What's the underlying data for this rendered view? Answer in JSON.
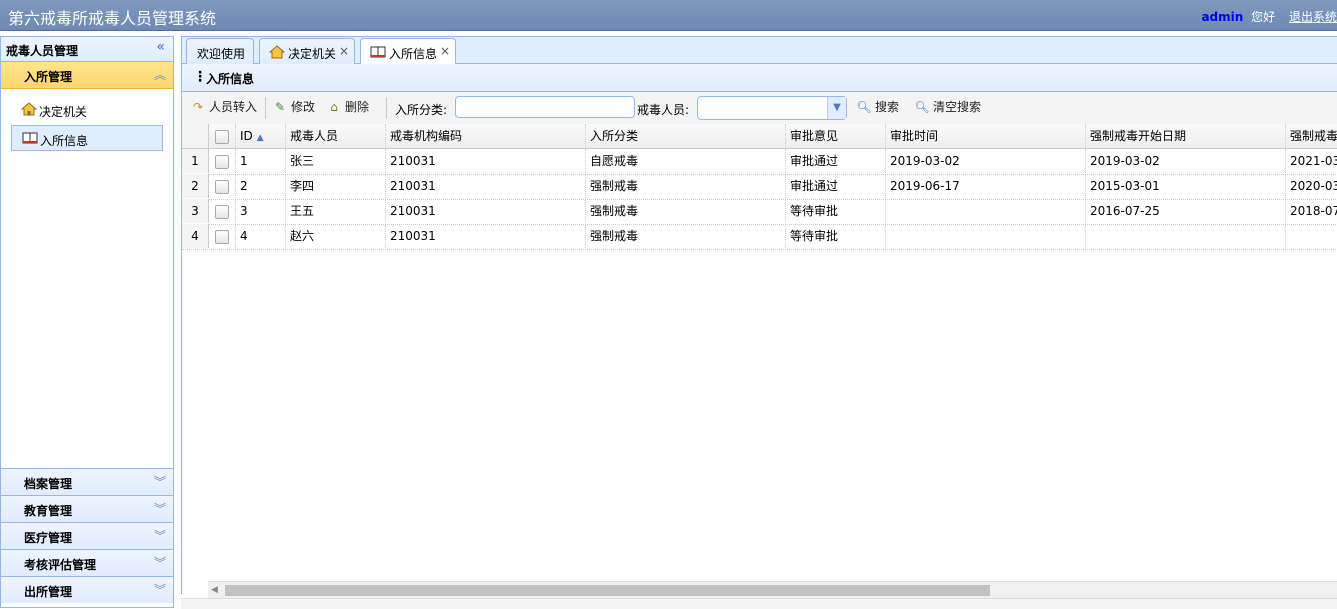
{
  "app": {
    "title": "第六戒毒所戒毒人员管理系统",
    "user": "admin",
    "greeting": "您好",
    "logout": "退出系统"
  },
  "sidebar": {
    "header": "戒毒人员管理",
    "active_group": "入所管理",
    "items": [
      {
        "label": "决定机关",
        "icon": "house-icon"
      },
      {
        "label": "入所信息",
        "icon": "book-icon"
      }
    ],
    "groups": [
      "档案管理",
      "教育管理",
      "医疗管理",
      "考核评估管理",
      "出所管理"
    ]
  },
  "tabs": [
    {
      "label": "欢迎使用"
    },
    {
      "label": "决定机关",
      "icon": "house-icon"
    },
    {
      "label": "入所信息",
      "icon": "book-icon"
    }
  ],
  "panel": {
    "title": "入所信息"
  },
  "toolbar": {
    "transfer": "人员转入",
    "edit": "修改",
    "delete": "删除",
    "category_label": "入所分类:",
    "category_value": "",
    "person_label": "戒毒人员:",
    "person_value": "",
    "search": "搜索",
    "clear": "清空搜索"
  },
  "grid": {
    "columns": [
      "ID",
      "戒毒人员",
      "戒毒机构编码",
      "入所分类",
      "审批意见",
      "审批时间",
      "强制戒毒开始日期",
      "强制戒毒"
    ],
    "rows": [
      {
        "n": "1",
        "id": "1",
        "name": "张三",
        "code": "210031",
        "cat": "自愿戒毒",
        "opinion": "审批通过",
        "time": "2019-03-02",
        "start": "2019-03-02",
        "end": "2021-03"
      },
      {
        "n": "2",
        "id": "2",
        "name": "李四",
        "code": "210031",
        "cat": "强制戒毒",
        "opinion": "审批通过",
        "time": "2019-06-17",
        "start": "2015-03-01",
        "end": "2020-03"
      },
      {
        "n": "3",
        "id": "3",
        "name": "王五",
        "code": "210031",
        "cat": "强制戒毒",
        "opinion": "等待审批",
        "time": "",
        "start": "2016-07-25",
        "end": "2018-07"
      },
      {
        "n": "4",
        "id": "4",
        "name": "赵六",
        "code": "210031",
        "cat": "强制戒毒",
        "opinion": "等待审批",
        "time": "",
        "start": "",
        "end": ""
      }
    ]
  },
  "colors": {
    "border": "#95b8e7",
    "header_bg": "#e0ecff",
    "topbar": "#7f99be",
    "active_group": "#ffd66f"
  }
}
